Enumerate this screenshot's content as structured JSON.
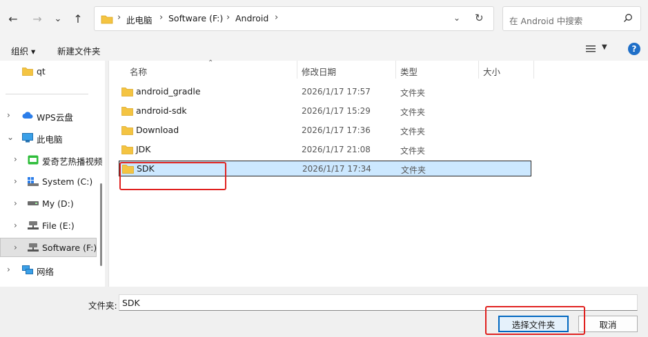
{
  "address": {
    "crumbs": [
      "此电脑",
      "Software (F:)",
      "Android"
    ],
    "search_placeholder": "在 Android 中搜索"
  },
  "toolbar": {
    "organize_label": "组织 ▾",
    "new_folder_label": "新建文件夹"
  },
  "nav": {
    "items": [
      {
        "label": "qt",
        "icon": "folder-icon",
        "chevron": ""
      },
      {
        "label": "WPS云盘",
        "icon": "cloud-icon",
        "chevron": "›"
      },
      {
        "label": "此电脑",
        "icon": "pc-icon",
        "chevron": "⌄"
      },
      {
        "label": "爱奇艺热播视频",
        "icon": "iqiyi-icon",
        "chevron": "›"
      },
      {
        "label": "System (C:)",
        "icon": "system-drive-icon",
        "chevron": "›"
      },
      {
        "label": "My (D:)",
        "icon": "drive-icon",
        "chevron": "›"
      },
      {
        "label": "File (E:)",
        "icon": "network-drive-icon",
        "chevron": "›"
      },
      {
        "label": "Software (F:)",
        "icon": "network-drive-icon",
        "chevron": "›"
      },
      {
        "label": "网络",
        "icon": "network-icon",
        "chevron": "›"
      }
    ]
  },
  "columns": {
    "name": "名称",
    "modified": "修改日期",
    "type": "类型",
    "size": "大小"
  },
  "files": [
    {
      "name": "android_gradle",
      "modified": "2026/1/17 17:57",
      "type": "文件夹"
    },
    {
      "name": "android-sdk",
      "modified": "2026/1/17 15:29",
      "type": "文件夹"
    },
    {
      "name": "Download",
      "modified": "2026/1/17 17:36",
      "type": "文件夹"
    },
    {
      "name": "JDK",
      "modified": "2026/1/17 21:08",
      "type": "文件夹"
    },
    {
      "name": "SDK",
      "modified": "2026/1/17 17:34",
      "type": "文件夹",
      "selected": true
    }
  ],
  "footer": {
    "folder_label": "文件夹:",
    "folder_value": "SDK",
    "select_button": "选择文件夹",
    "cancel_button": "取消"
  },
  "colors": {
    "selection": "#cce8ff",
    "highlight": "#e0201e",
    "folder": "#f4c442",
    "accent": "#0067c0"
  }
}
